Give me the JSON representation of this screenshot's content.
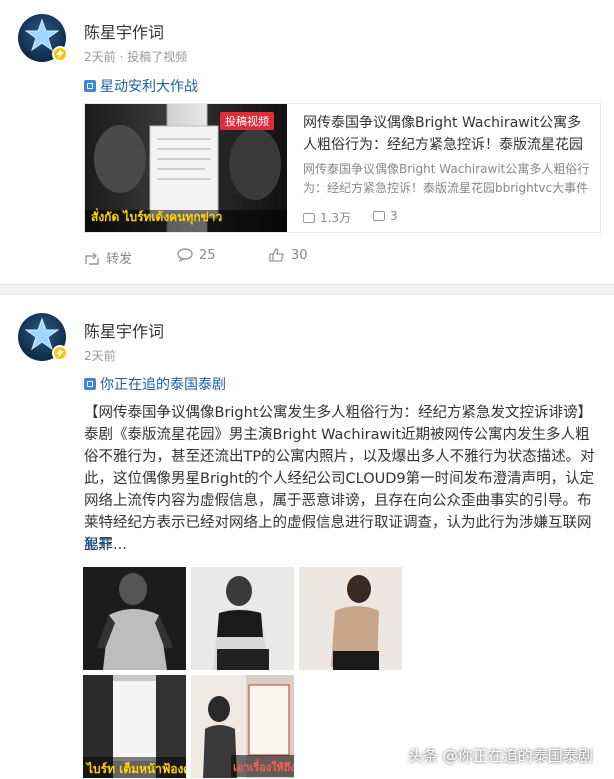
{
  "posts": [
    {
      "author": "陈星宇作词",
      "meta": "2天前 · 投稿了视频",
      "topic": "星动安利大作战",
      "card": {
        "title": "网传泰国争议偶像Bright Wachirawit公寓多人粗俗行为：经纪方紧急控诉！泰版流星花园",
        "desc": "网传泰国争议偶像Bright Wachirawit公寓多人粗俗行为：经纪方紧急控诉！泰版流星花园bbrightvc大事件",
        "thumb_tag": "投稿视频",
        "thumb_caption": "สั่งกัด ไบร์ทเด้งคนทุกข่าว",
        "plays": "1.3万",
        "comments": "3"
      },
      "actions": {
        "repost": "转发",
        "comment": "25",
        "like": "30"
      }
    },
    {
      "author": "陈星宇作词",
      "meta": "2天前",
      "topic": "你正在追的泰国泰剧",
      "text": "【网传泰国争议偶像Bright公寓发生多人粗俗行为：经纪方紧急发文控诉诽谤】泰剧《泰版流星花园》男主演Bright Wachirawit近期被网传公寓内发生多人粗俗不雅行为，甚至还流出TP的公寓内照片，以及爆出多人不雅行为状态描述。对此，这位偶像男星Bright的个人经纪公司CLOUD9第一时间发布澄清声明，认定网络上流传内容为虚假信息，属于恶意诽谤，且存在向公众歪曲事实的引导。布莱特经纪方表示已经对网络上的虚假信息进行取证调查，认为此行为涉嫌互联网犯罪...",
      "expand": "展开",
      "image_captions": [
        "ไบร์ท เต็มหน้าฟ้องศ",
        "เอาเรื่องให้ถึง"
      ]
    }
  ],
  "watermark": "头条 @你正在追的泰国泰剧",
  "colors": {
    "link": "#1d5fa8",
    "badge": "#ffc400",
    "divider": "#f2f2f2"
  }
}
